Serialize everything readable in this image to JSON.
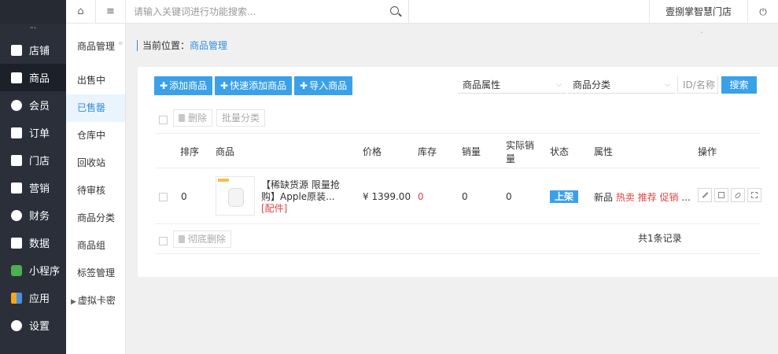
{
  "nav": {
    "toggle_icon": "collapse-icon",
    "items": [
      {
        "label": "店铺",
        "icon": "store-icon"
      },
      {
        "label": "商品",
        "icon": "goods-icon",
        "active": true
      },
      {
        "label": "会员",
        "icon": "member-icon"
      },
      {
        "label": "订单",
        "icon": "order-icon"
      },
      {
        "label": "门店",
        "icon": "shop-icon"
      },
      {
        "label": "营销",
        "icon": "gift-icon"
      },
      {
        "label": "财务",
        "icon": "finance-icon"
      },
      {
        "label": "数据",
        "icon": "chart-icon"
      },
      {
        "label": "小程序",
        "icon": "miniprogram-icon"
      },
      {
        "label": "应用",
        "icon": "apps-icon"
      },
      {
        "label": "设置",
        "icon": "gear-icon"
      }
    ]
  },
  "subnav": {
    "title": "商品管理",
    "collapse": "«",
    "items": [
      "出售中",
      "已售罄",
      "仓库中",
      "回收站",
      "待审核",
      "商品分类",
      "商品组",
      "标签管理",
      "虚拟卡密"
    ],
    "active_index": 1
  },
  "topbar": {
    "search_placeholder": "请输入关键词进行功能搜索...",
    "store_name": "壹捌掌智慧门店",
    "power_glyph": "⏻",
    "mark": "ˇ"
  },
  "breadcrumb": {
    "prefix": "当前位置：",
    "current": "商品管理"
  },
  "toolbar": {
    "add": "添加商品",
    "quick_add": "快速添加商品",
    "import": "导入商品",
    "attr_select": "商品属性",
    "cat_select": "商品分类",
    "id_placeholder": "ID/名称",
    "search": "搜索",
    "delete": "删除",
    "batch_category": "批量分类",
    "perm_delete": "彻底删除"
  },
  "table": {
    "headers": {
      "sort": "排序",
      "goods": "商品",
      "price": "价格",
      "stock": "库存",
      "sales": "销量",
      "real_sales_1": "实际销",
      "real_sales_2": "量",
      "status": "状态",
      "attrs": "属性",
      "ops": "操作"
    },
    "rows": [
      {
        "sort": "0",
        "title_1": "【稀缺货源 限量抢",
        "title_2": "购】Apple原装...",
        "tag": "[配件]",
        "price": "¥ 1399.00",
        "stock": "0",
        "sales": "0",
        "real_sales": "0",
        "status": "上架",
        "attr_new": "新品",
        "attr_hot": "热卖",
        "attr_rec": "推荐",
        "attr_promo": "促销",
        "attr_more": "...",
        "op_icons": [
          "edit-icon",
          "trash-icon",
          "link-icon",
          "qrcode-icon"
        ]
      }
    ],
    "total": "共1条记录"
  },
  "colors": {
    "accent": "#3aa1e8",
    "nav_bg": "#2a2f3a",
    "danger": "#e64340"
  }
}
